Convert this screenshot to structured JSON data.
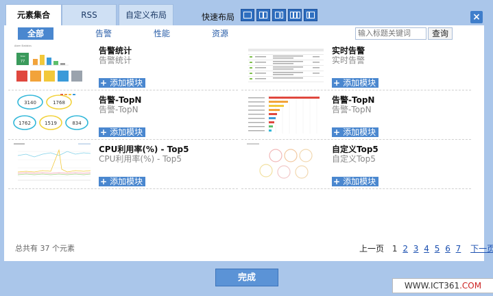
{
  "tabs": [
    {
      "label": "元素集合",
      "active": true
    },
    {
      "label": "RSS",
      "active": false
    },
    {
      "label": "自定义布局",
      "active": false
    }
  ],
  "quick_layout_label": "快速布局",
  "layout_icons": [
    "layout-1col-icon",
    "layout-2col-icon",
    "layout-2col-alt-icon",
    "layout-3col-icon",
    "layout-2col-right-icon"
  ],
  "close_label": "×",
  "categories": [
    {
      "label": "全部",
      "active": true
    },
    {
      "label": "告警",
      "active": false
    },
    {
      "label": "性能",
      "active": false
    },
    {
      "label": "资源",
      "active": false
    }
  ],
  "search": {
    "placeholder": "输入标题关键词",
    "button": "查询"
  },
  "items": [
    {
      "title": "告警统计",
      "subtitle": "告警统计",
      "add_label": "添加模块",
      "thumb": "alarm-stats-thumbnail"
    },
    {
      "title": "实时告警",
      "subtitle": "实时告警",
      "add_label": "添加模块",
      "thumb": "realtime-alarm-thumbnail"
    },
    {
      "title": "告警-TopN",
      "subtitle": "告警-TopN",
      "add_label": "添加模块",
      "thumb": "alarm-topn-circles-thumbnail"
    },
    {
      "title": "告警-TopN",
      "subtitle": "告警-TopN",
      "add_label": "添加模块",
      "thumb": "alarm-topn-bars-thumbnail"
    },
    {
      "title": "CPU利用率(%) - Top5",
      "subtitle": "CPU利用率(%) - Top5",
      "add_label": "添加模块",
      "thumb": "cpu-top5-thumbnail"
    },
    {
      "title": "自定义Top5",
      "subtitle": "自定义Top5",
      "add_label": "添加模块",
      "thumb": "custom-top5-thumbnail"
    }
  ],
  "thumb_text": {
    "alarm_stat_heading": "Alarm Statistics",
    "alarm_stat_total": "Total",
    "alarm_stat_count": "77",
    "circle_values": [
      "3140",
      "1768",
      "1762",
      "1519",
      "834"
    ]
  },
  "footer": {
    "total": "总共有 37 个元素",
    "prev": "上一页",
    "current_page": "1",
    "pages": [
      "2",
      "3",
      "4",
      "5",
      "6",
      "7"
    ],
    "next": "下一页"
  },
  "done_label": "完成",
  "watermark": {
    "prefix": "WWW.ICT361",
    "suffix": ".COM"
  },
  "colors": {
    "accent": "#4a87cf",
    "tab_bg": "#cfe0f4",
    "frame_bg": "#aac6ea"
  }
}
